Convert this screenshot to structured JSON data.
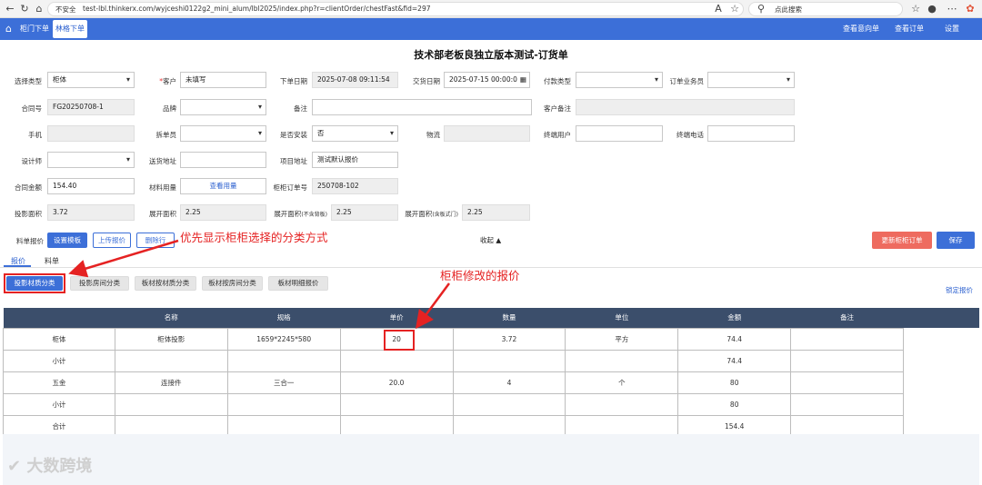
{
  "browser": {
    "insecure_label": "不安全",
    "url": "test-lbl.thinkerx.com/wyjceshi0122g2_mini_alum/lbl2025/index.php?r=clientOrder/chestFast&fid=297",
    "search_placeholder": "点此搜索"
  },
  "nav": {
    "items": [
      "柜门下单",
      "林格下单"
    ],
    "right_links": [
      "查看意向单",
      "查看订单",
      "设置"
    ]
  },
  "page_title": "技术部老板良独立版本测试-订货单",
  "form": {
    "select_type": {
      "label": "选择类型",
      "value": "柜体"
    },
    "customer": {
      "label": "客户",
      "required_mark": "*",
      "value": "未填写"
    },
    "order_date": {
      "label": "下单日期",
      "value": "2025-07-08 09:11:54"
    },
    "delivery_date": {
      "label": "交货日期",
      "value": "2025-07-15 00:00:0"
    },
    "payment_type": {
      "label": "付款类型",
      "value": ""
    },
    "salesperson": {
      "label": "订单业务员",
      "value": ""
    },
    "contract_no": {
      "label": "合同号",
      "value": "FG20250708-1"
    },
    "brand": {
      "label": "品牌",
      "value": ""
    },
    "remark": {
      "label": "备注",
      "value": ""
    },
    "customer_remark": {
      "label": "客户备注",
      "value": ""
    },
    "phone": {
      "label": "手机",
      "value": ""
    },
    "disassembler": {
      "label": "拆单员",
      "value": ""
    },
    "need_install": {
      "label": "是否安装",
      "value": "否"
    },
    "logistics": {
      "label": "物流",
      "value": ""
    },
    "end_user": {
      "label": "终端用户",
      "value": ""
    },
    "end_phone": {
      "label": "终端电话",
      "value": ""
    },
    "designer": {
      "label": "设计师",
      "value": ""
    },
    "ship_address": {
      "label": "送货地址",
      "value": ""
    },
    "project_address": {
      "label": "项目地址",
      "value": "测试默认报价"
    },
    "contract_amount": {
      "label": "合同金额",
      "value": "154.40"
    },
    "material_usage": {
      "label": "材料用量",
      "button": "查看用量"
    },
    "cabinet_order_no": {
      "label": "柜柜订单号",
      "value": "250708-102"
    },
    "projected_area": {
      "label": "投影面积",
      "value": "3.72"
    },
    "unfold_area": {
      "label": "展开面积",
      "value": "2.25"
    },
    "unfold_area_no_back": {
      "label": "展开面积",
      "label_small": "(不含背板)",
      "value": "2.25"
    },
    "unfold_area_no_door": {
      "label": "展开面积",
      "label_small": "(含板式门)",
      "value": "2.25"
    }
  },
  "toolbar": {
    "label": "料单报价",
    "set_template": "设置模板",
    "upload_quote": "上传报价",
    "delete_row": "删除行",
    "collapse": "收起",
    "update_order": "更新柜柜订单",
    "save": "保存"
  },
  "tabs": [
    "报价",
    "料单"
  ],
  "category_buttons": [
    "投影材质分类",
    "投影房间分类",
    "板材按材质分类",
    "板材按房间分类",
    "板材明细报价"
  ],
  "lock_quote": "锁定报价",
  "table": {
    "headers": [
      "",
      "名称",
      "规格",
      "单价",
      "数量",
      "单位",
      "金额",
      "备注"
    ],
    "rows": [
      [
        "柜体",
        "柜体投影",
        "1659*2245*580",
        "20",
        "3.72",
        "平方",
        "74.4",
        ""
      ],
      [
        "小计",
        "",
        "",
        "",
        "",
        "",
        "74.4",
        ""
      ],
      [
        "五金",
        "连接件",
        "三合一",
        "20.0",
        "4",
        "个",
        "80",
        ""
      ],
      [
        "小计",
        "",
        "",
        "",
        "",
        "",
        "80",
        ""
      ],
      [
        "合计",
        "",
        "",
        "",
        "",
        "",
        "154.4",
        ""
      ]
    ]
  },
  "annotations": {
    "category_note": "优先显示柜柜选择的分类方式",
    "price_note": "柜柜修改的报价"
  },
  "watermark": "大数跨境",
  "colors": {
    "nav_blue": "#3c6fd8",
    "table_header": "#3b4e6b",
    "annotation_red": "#e52222",
    "update_button": "#ee6b5f"
  }
}
